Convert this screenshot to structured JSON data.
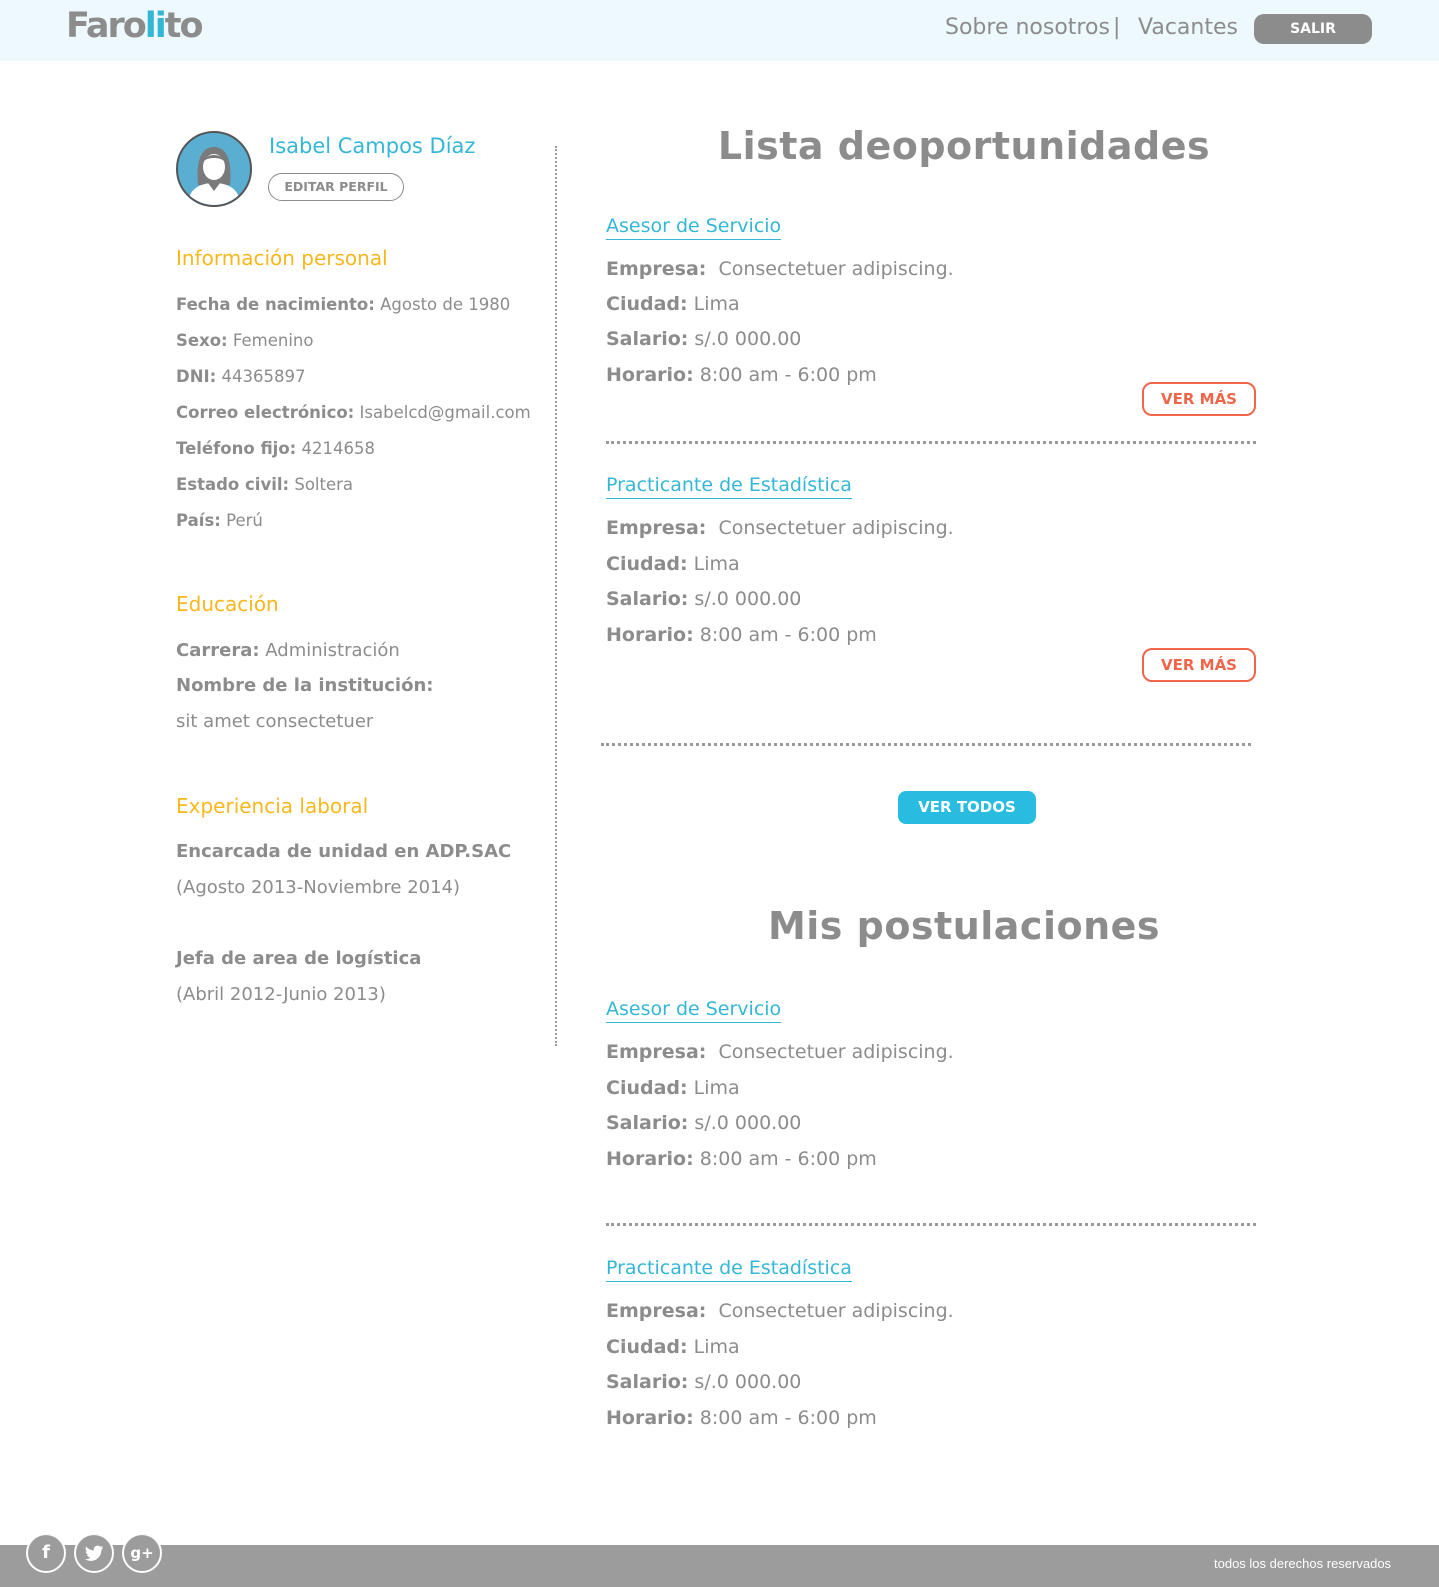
{
  "header": {
    "logo_main": "Faro",
    "logo_accent": "li",
    "logo_tail": "to",
    "nav": [
      "Sobre nosotros",
      "Vacantes"
    ],
    "separator": "|",
    "logout": "SALIR"
  },
  "profile": {
    "name": "Isabel Campos Díaz",
    "edit_label": "EDITAR PERFIL"
  },
  "personal": {
    "title": "Información personal",
    "fields": [
      {
        "label": "Fecha de nacimiento:",
        "value": "Agosto de 1980"
      },
      {
        "label": "Sexo:",
        "value": "Femenino"
      },
      {
        "label": "DNI:",
        "value": "44365897"
      },
      {
        "label": "Correo electrónico:",
        "value": "Isabelcd@gmail.com"
      },
      {
        "label": "Teléfono fijo:",
        "value": "4214658"
      },
      {
        "label": "Estado civil:",
        "value": "Soltera"
      },
      {
        "label": "País:",
        "value": "Perú"
      }
    ]
  },
  "education": {
    "title": "Educación",
    "career_label": "Carrera:",
    "career_value": "Administración",
    "institution_label": "Nombre de la institución:",
    "institution_value": "sit amet consectetuer"
  },
  "experience": {
    "title": "Experiencia laboral",
    "items": [
      {
        "role": "Encarcada de unidad en ADP.SAC",
        "period": "(Agosto 2013-Noviembre 2014)"
      },
      {
        "role": "Jefa de area de logística",
        "period": "(Abril 2012-Junio 2013)"
      }
    ]
  },
  "opportunities": {
    "title": "Lista deoportunidades",
    "jobs": [
      {
        "title": "Asesor de Servicio",
        "empresa_label": "Empresa:",
        "empresa": "Consectetuer adipiscing.",
        "ciudad_label": "Ciudad:",
        "ciudad": "Lima",
        "salario_label": "Salario:",
        "salario": "s/.0 000.00",
        "horario_label": "Horario:",
        "horario": "8:00 am - 6:00 pm",
        "button": "VER MÁS"
      },
      {
        "title": "Practicante de Estadística",
        "empresa_label": "Empresa:",
        "empresa": "Consectetuer adipiscing.",
        "ciudad_label": "Ciudad:",
        "ciudad": "Lima",
        "salario_label": "Salario:",
        "salario": "s/.0 000.00",
        "horario_label": "Horario:",
        "horario": "8:00 am - 6:00 pm",
        "button": "VER MÁS"
      }
    ],
    "see_all": "VER TODOS"
  },
  "applications": {
    "title": "Mis postulaciones",
    "jobs": [
      {
        "title": "Asesor de Servicio",
        "empresa_label": "Empresa:",
        "empresa": "Consectetuer adipiscing.",
        "ciudad_label": "Ciudad:",
        "ciudad": "Lima",
        "salario_label": "Salario:",
        "salario": "s/.0 000.00",
        "horario_label": "Horario:",
        "horario": "8:00 am - 6:00 pm"
      },
      {
        "title": "Practicante de Estadística",
        "empresa_label": "Empresa:",
        "empresa": "Consectetuer adipiscing.",
        "ciudad_label": "Ciudad:",
        "ciudad": "Lima",
        "salario_label": "Salario:",
        "salario": "s/.0 000.00",
        "horario_label": "Horario:",
        "horario": "8:00 am - 6:00 pm"
      }
    ]
  },
  "footer": {
    "social": [
      {
        "name": "facebook-icon",
        "glyph": "f"
      },
      {
        "name": "twitter-icon",
        "glyph": "t"
      },
      {
        "name": "google-plus-icon",
        "glyph": "g+"
      }
    ],
    "copyright": "todos los derechos reservados"
  },
  "colors": {
    "accent_blue": "#34b7d6",
    "accent_yellow": "#f7b71d",
    "accent_orange": "#f0664a",
    "text_gray": "#8c8c8c",
    "header_bg": "#edf9fc"
  }
}
